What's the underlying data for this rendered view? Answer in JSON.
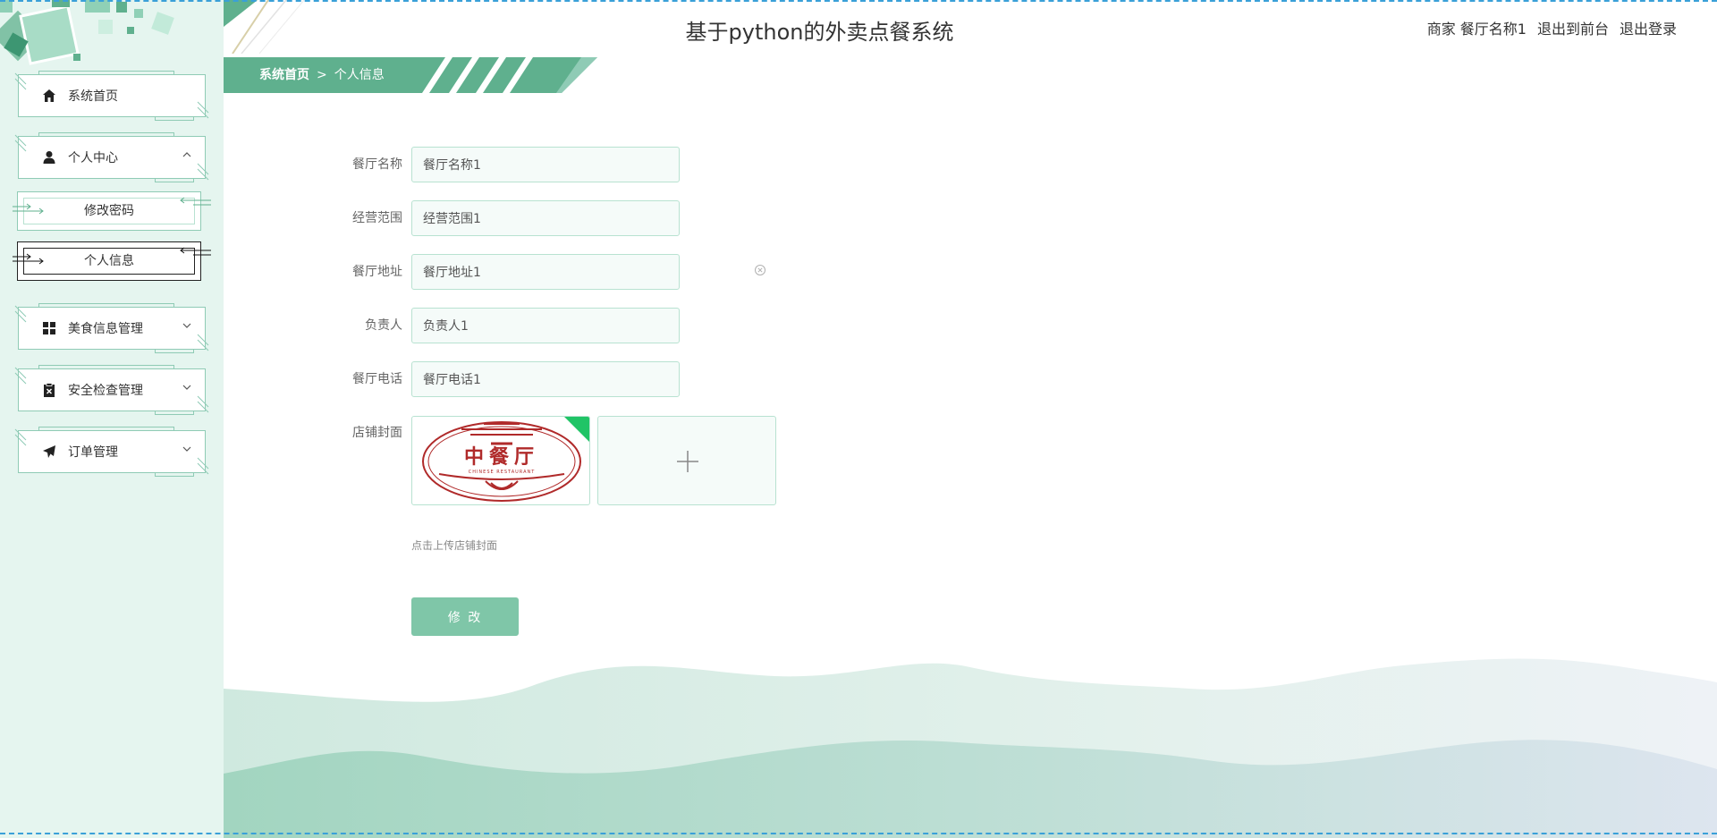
{
  "app": {
    "title": "基于python的外卖点餐系统"
  },
  "header": {
    "user_label": "商家 餐厅名称1",
    "to_front_label": "退出到前台",
    "logout_label": "退出登录"
  },
  "breadcrumb": {
    "home": "系统首页",
    "separator": ">",
    "current": "个人信息"
  },
  "sidebar": {
    "items": [
      {
        "label": "系统首页",
        "icon": "home-icon"
      },
      {
        "label": "个人中心",
        "icon": "user-icon",
        "expanded": true,
        "children": [
          {
            "label": "修改密码"
          },
          {
            "label": "个人信息",
            "active": true
          }
        ]
      },
      {
        "label": "美食信息管理",
        "icon": "grid-icon"
      },
      {
        "label": "安全检查管理",
        "icon": "clipboard-icon"
      },
      {
        "label": "订单管理",
        "icon": "send-icon"
      }
    ]
  },
  "form": {
    "restaurant_name": {
      "label": "餐厅名称",
      "value": "餐厅名称1"
    },
    "business_scope": {
      "label": "经营范围",
      "value": "经营范围1"
    },
    "address": {
      "label": "餐厅地址",
      "value": "餐厅地址1"
    },
    "manager": {
      "label": "负责人",
      "value": "负责人1"
    },
    "phone": {
      "label": "餐厅电话",
      "value": "餐厅电话1"
    },
    "cover": {
      "label": "店铺封面",
      "image_text": "中餐厅",
      "image_subtext": "CHINESE RESTAURANT",
      "upload_tip": "点击上传店铺封面"
    },
    "submit_label": "修 改"
  },
  "colors": {
    "accent": "#5fb08e",
    "sidebar_bg": "#e5f5ef",
    "input_border": "#b8e2d1",
    "button_bg": "#7fc6a8",
    "logo_red": "#b02a2a"
  }
}
